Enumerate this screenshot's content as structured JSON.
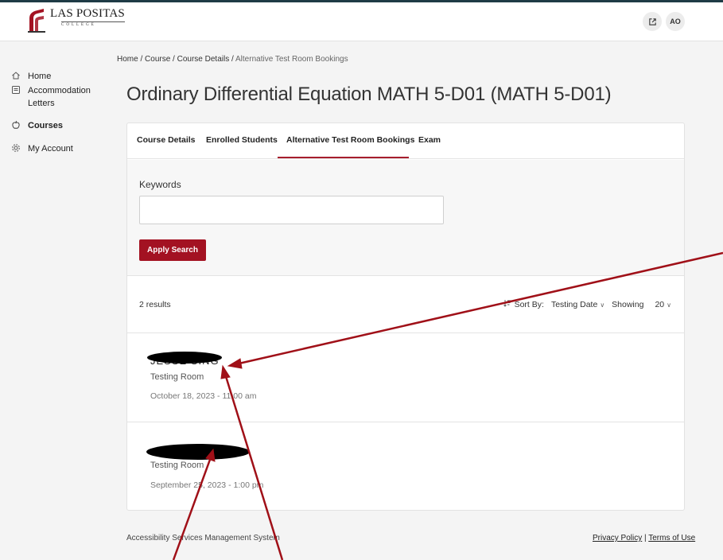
{
  "header": {
    "logo_title": "LAS POSITAS",
    "logo_subtitle": "COLLEGE",
    "avatar_initials": "AO"
  },
  "sidebar": {
    "items": [
      {
        "label": "Home",
        "icon": "home-icon"
      },
      {
        "label": "Accommodation Letters",
        "icon": "letter-icon"
      },
      {
        "label": "Courses",
        "icon": "apple-icon"
      },
      {
        "label": "My Account",
        "icon": "gear-icon"
      }
    ]
  },
  "breadcrumb": {
    "home": "Home",
    "course": "Course",
    "details": "Course Details",
    "current": "Alternative Test Room Bookings"
  },
  "page_title": "Ordinary Differential Equation MATH 5-D01 (MATH 5-D01)",
  "tabs": [
    "Course Details",
    "Enrolled Students",
    "Alternative Test Room Bookings",
    "Exam"
  ],
  "search": {
    "keywords_label": "Keywords",
    "keywords_value": "",
    "apply_label": "Apply Search"
  },
  "results": {
    "count_text": "2 results",
    "sort_label": "Sort By:",
    "sort_value": "Testing Date",
    "showing_label": "Showing",
    "showing_value": "20",
    "items": [
      {
        "name": "JESSE SING",
        "type": "Testing Room",
        "date": "October 18, 2023 - 11:00 am"
      },
      {
        "name": "",
        "type": "Testing Room",
        "date": "September 25, 2023 - 1:00 pm"
      }
    ]
  },
  "footer": {
    "left": "Accessibility Services Management System",
    "privacy": "Privacy Policy",
    "separator": " | ",
    "terms": "Terms of Use"
  },
  "colors": {
    "accent": "#a31222",
    "annotation_arrow": "#a01018",
    "top_stripe": "#1f3b46"
  }
}
